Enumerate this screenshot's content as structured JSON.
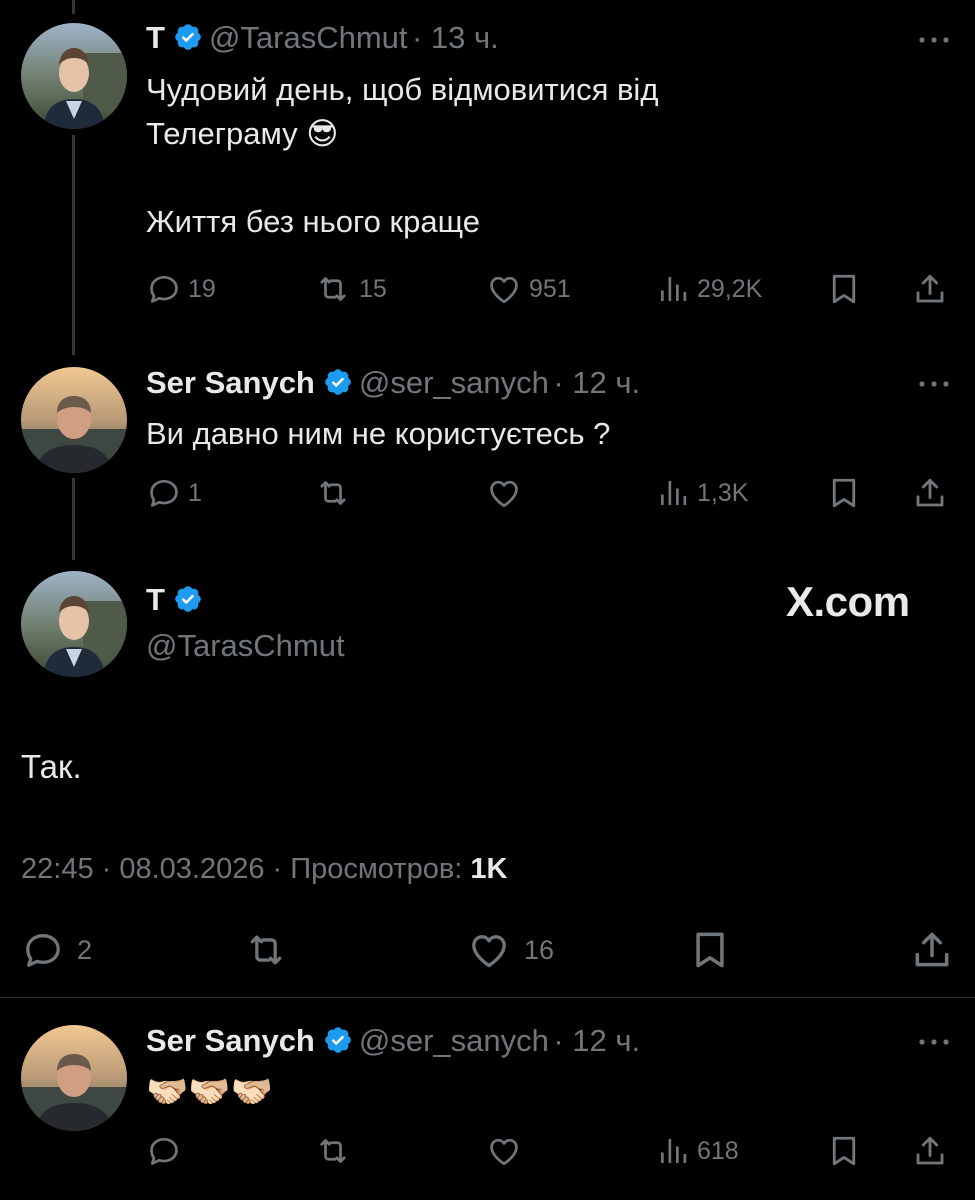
{
  "tweet1": {
    "name": "T",
    "handle": "@TarasChmut",
    "time": "· 13 ч.",
    "text": "Чудовий день, щоб відмовитися від\nТелеграму 😎\n\nЖиття без нього краще",
    "replies": "19",
    "reposts": "15",
    "likes": "951",
    "views": "29,2K"
  },
  "tweet2": {
    "name": "Ser Sanych",
    "handle": "@ser_sanych",
    "time": "· 12 ч.",
    "text": "Ви давно ним не користуєтесь ?",
    "replies": "1",
    "views": "1,3K"
  },
  "main": {
    "name": "T",
    "handle": "@TarasChmut",
    "brand": "X.com",
    "text": "Так.",
    "timestamp": "22:45 · 08.03.2026 · Просмотров: ",
    "views": "1K",
    "replies": "2",
    "likes": "16"
  },
  "tweet3": {
    "name": "Ser Sanych",
    "handle": "@ser_sanych",
    "time": "· 12 ч.",
    "text": "🫱🏻‍🫲🏼🫱🏻‍🫲🏼🫱🏻‍🫲🏼",
    "views": "618"
  },
  "colors": {
    "background": "#000000",
    "text": "#e7e9ea",
    "secondary": "#71767b",
    "verified": "#1d9bf0",
    "divider": "#2f3336"
  }
}
